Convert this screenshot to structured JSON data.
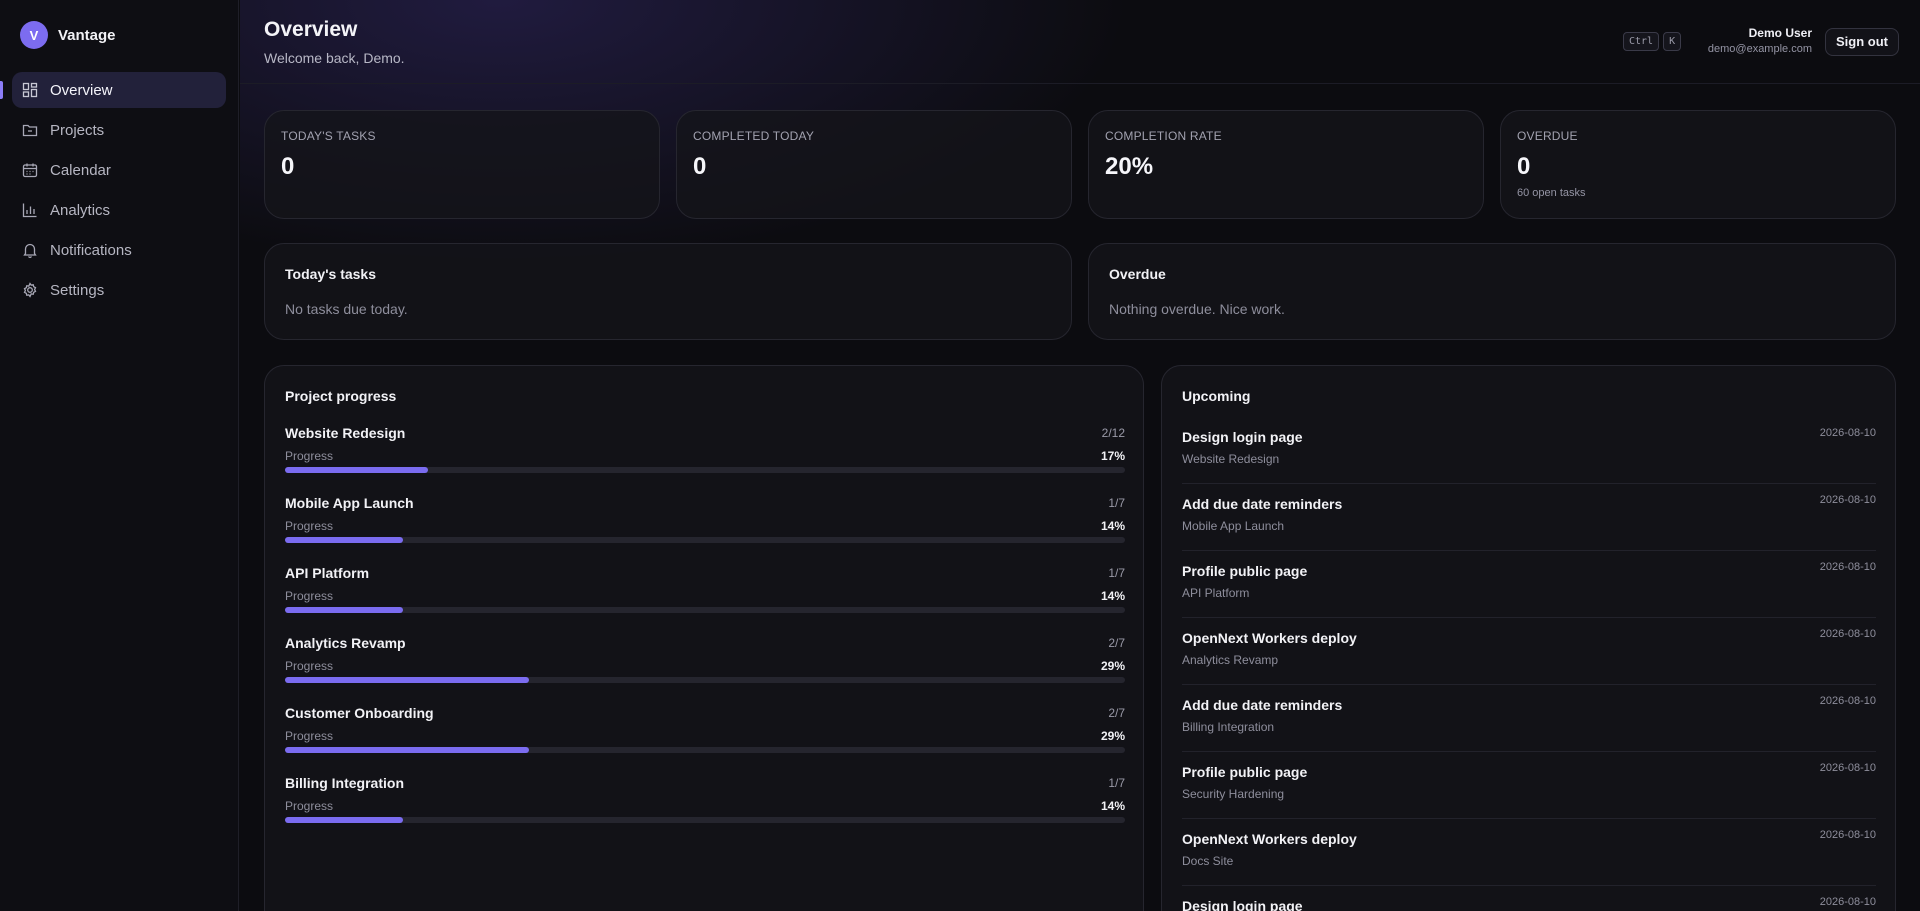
{
  "brand": {
    "initial": "V",
    "name": "Vantage",
    "accent": "#7c6cf0"
  },
  "sidebar": {
    "items": [
      {
        "label": "Overview",
        "icon": "dashboard-icon",
        "active": true
      },
      {
        "label": "Projects",
        "icon": "folder-icon"
      },
      {
        "label": "Calendar",
        "icon": "calendar-icon"
      },
      {
        "label": "Analytics",
        "icon": "bar-chart-icon"
      },
      {
        "label": "Notifications",
        "icon": "bell-icon"
      },
      {
        "label": "Settings",
        "icon": "gear-icon"
      }
    ]
  },
  "header": {
    "title": "Overview",
    "subtitle": "Welcome back, Demo.",
    "shortcut": [
      "Ctrl",
      "K"
    ],
    "user_name": "Demo User",
    "user_email": "demo@example.com",
    "signout_label": "Sign out"
  },
  "stats": [
    {
      "label": "TODAY'S TASKS",
      "value": "0",
      "note": ""
    },
    {
      "label": "COMPLETED TODAY",
      "value": "0",
      "note": ""
    },
    {
      "label": "COMPLETION RATE",
      "value": "20%",
      "note": ""
    },
    {
      "label": "OVERDUE",
      "value": "0",
      "note": "60 open tasks"
    }
  ],
  "today_panel": {
    "title": "Today's tasks",
    "empty": "No tasks due today."
  },
  "overdue_panel": {
    "title": "Overdue",
    "empty": "Nothing overdue. Nice work."
  },
  "project_progress": {
    "title": "Project progress",
    "progress_label": "Progress",
    "projects": [
      {
        "name": "Website Redesign",
        "count": "2/12",
        "percent_label": "17%",
        "fraction": 0.17
      },
      {
        "name": "Mobile App Launch",
        "count": "1/7",
        "percent_label": "14%",
        "fraction": 0.14
      },
      {
        "name": "API Platform",
        "count": "1/7",
        "percent_label": "14%",
        "fraction": 0.14
      },
      {
        "name": "Analytics Revamp",
        "count": "2/7",
        "percent_label": "29%",
        "fraction": 0.29
      },
      {
        "name": "Customer Onboarding",
        "count": "2/7",
        "percent_label": "29%",
        "fraction": 0.29
      },
      {
        "name": "Billing Integration",
        "count": "1/7",
        "percent_label": "14%",
        "fraction": 0.14
      }
    ]
  },
  "upcoming": {
    "title": "Upcoming",
    "items": [
      {
        "title": "Design login page",
        "project": "Website Redesign",
        "date": "2026-08-10"
      },
      {
        "title": "Add due date reminders",
        "project": "Mobile App Launch",
        "date": "2026-08-10"
      },
      {
        "title": "Profile public page",
        "project": "API Platform",
        "date": "2026-08-10"
      },
      {
        "title": "OpenNext Workers deploy",
        "project": "Analytics Revamp",
        "date": "2026-08-10"
      },
      {
        "title": "Add due date reminders",
        "project": "Billing Integration",
        "date": "2026-08-10"
      },
      {
        "title": "Profile public page",
        "project": "Security Hardening",
        "date": "2026-08-10"
      },
      {
        "title": "OpenNext Workers deploy",
        "project": "Docs Site",
        "date": "2026-08-10"
      },
      {
        "title": "Design login page",
        "project": "",
        "date": "2026-08-10"
      }
    ]
  }
}
